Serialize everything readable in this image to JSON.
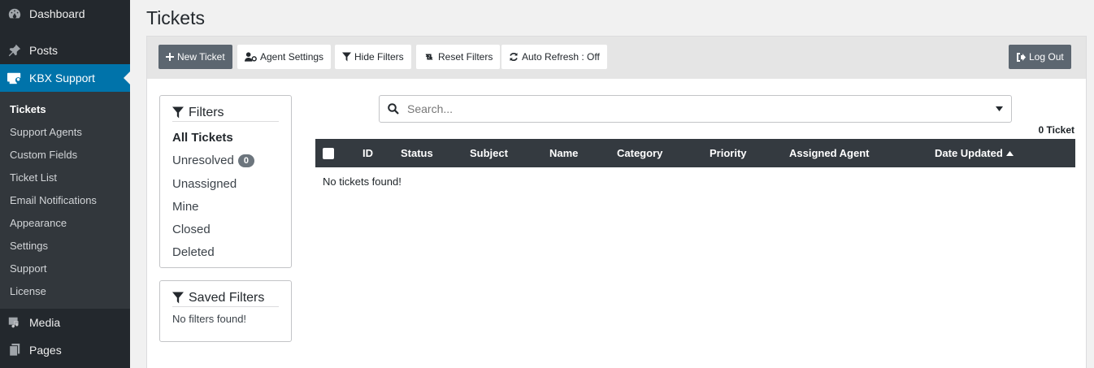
{
  "sidebar": {
    "dashboard": "Dashboard",
    "posts": "Posts",
    "kbx_support": "KBX Support",
    "submenu": [
      "Tickets",
      "Support Agents",
      "Custom Fields",
      "Ticket List",
      "Email Notifications",
      "Appearance",
      "Settings",
      "Support",
      "License"
    ],
    "media": "Media",
    "pages": "Pages"
  },
  "page": {
    "title": "Tickets"
  },
  "toolbar": {
    "new_ticket": "New Ticket",
    "agent_settings": "Agent Settings",
    "hide_filters": "Hide Filters",
    "reset_filters": "Reset Filters",
    "auto_refresh": "Auto Refresh : Off",
    "log_out": "Log Out"
  },
  "filters": {
    "title": "Filters",
    "items": [
      "All Tickets",
      "Unresolved",
      "Unassigned",
      "Mine",
      "Closed",
      "Deleted"
    ],
    "unresolved_count": "0"
  },
  "saved_filters": {
    "title": "Saved Filters",
    "empty": "No filters found!"
  },
  "search": {
    "placeholder": "Search..."
  },
  "ticket_count": "0 Ticket",
  "table": {
    "columns": [
      "ID",
      "Status",
      "Subject",
      "Name",
      "Category",
      "Priority",
      "Assigned Agent",
      "Date Updated"
    ],
    "empty": "No tickets found!"
  },
  "colors": {
    "sidebar": "#23282d",
    "active": "#0073aa",
    "table_header": "#343a40",
    "dark_button": "#5c6670"
  }
}
